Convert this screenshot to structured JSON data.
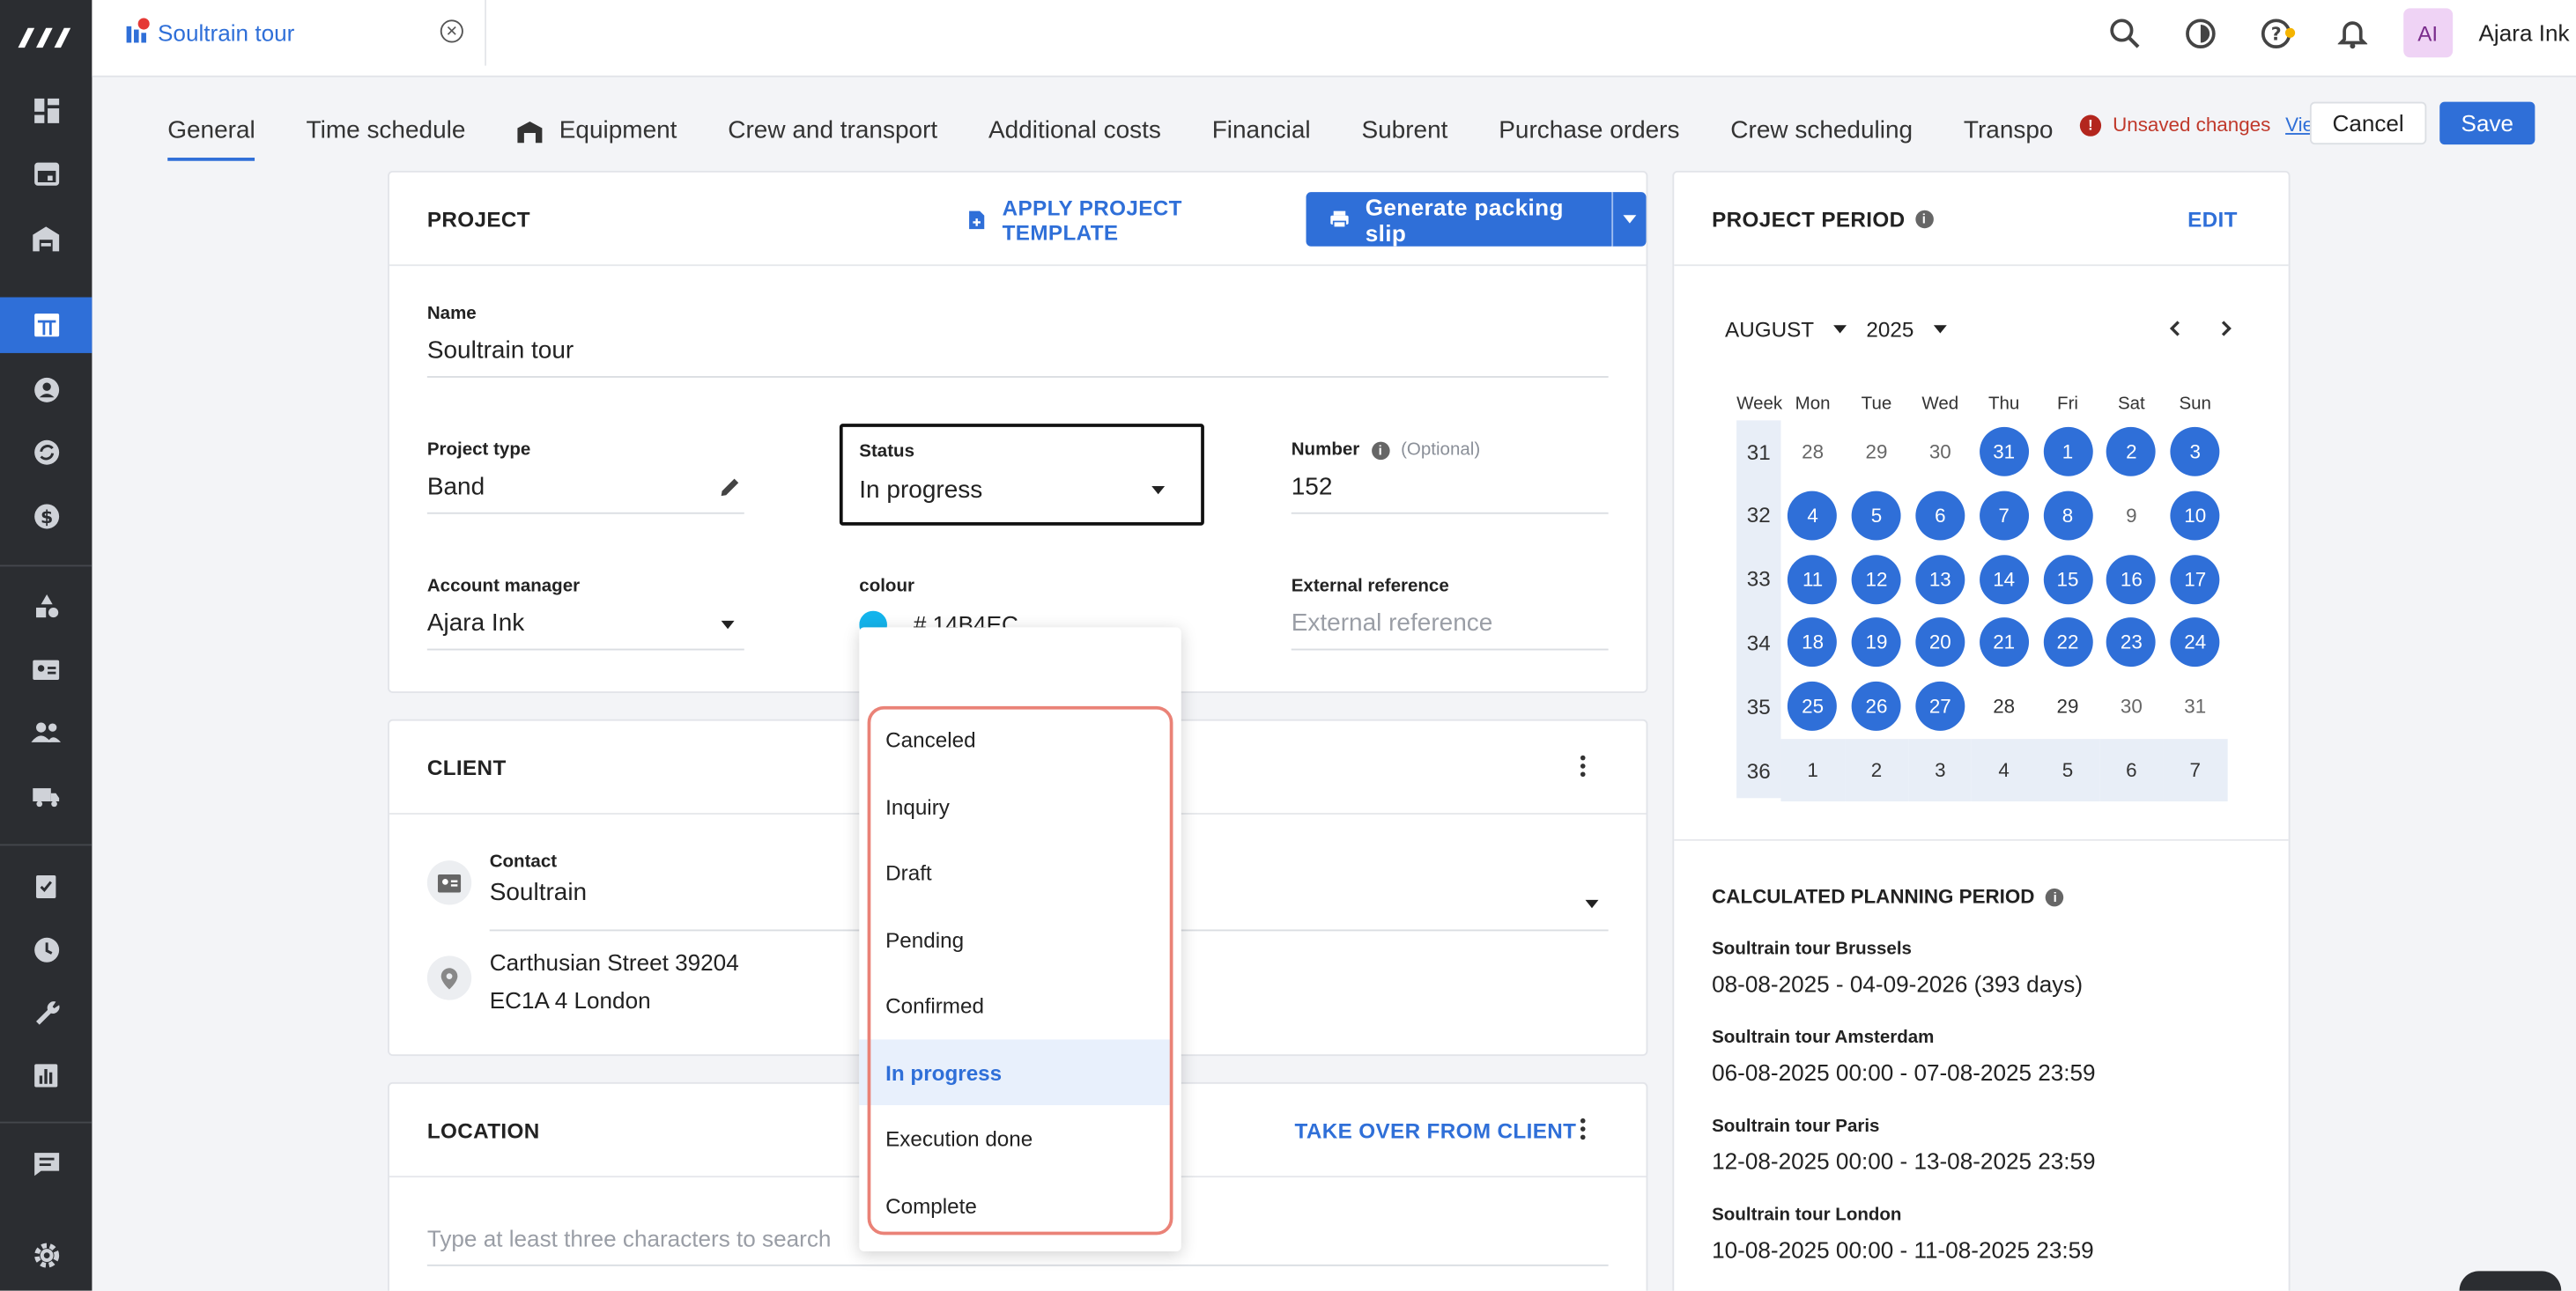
{
  "colors": {
    "accent": "#2f6fd8",
    "sidebar_bg": "#2b2d31",
    "highlight": "#ea8277",
    "swatch": "#14B4EC"
  },
  "window": {
    "tab_title": "Soultrain tour"
  },
  "user": {
    "initials": "AI",
    "name": "Ajara Ink"
  },
  "nav": {
    "tabs": [
      "General",
      "Time schedule",
      "Equipment",
      "Crew and transport",
      "Additional costs",
      "Financial",
      "Subrent",
      "Purchase orders",
      "Crew scheduling",
      "Transport pla"
    ],
    "active": "General"
  },
  "toolbar": {
    "unsaved": "Unsaved changes",
    "view": "View",
    "cancel": "Cancel",
    "save": "Save"
  },
  "project": {
    "heading": "PROJECT",
    "apply_template": "APPLY PROJECT TEMPLATE",
    "packing_slip": "Generate packing slip",
    "name_label": "Name",
    "name_value": "Soultrain tour",
    "type_label": "Project type",
    "type_value": "Band",
    "status_label": "Status",
    "status_value": "In progress",
    "number_label": "Number",
    "number_optional": "(Optional)",
    "number_value": "152",
    "manager_label": "Account manager",
    "manager_value": "Ajara Ink",
    "colour_label": "colour",
    "colour_value": "# 14B4EC",
    "extref_label": "External reference",
    "extref_placeholder": "External reference"
  },
  "client": {
    "heading": "CLIENT",
    "contact_label": "Contact",
    "contact_value": "Soultrain",
    "address_line1": "Carthusian Street 39204",
    "address_line2": "EC1A 4 London"
  },
  "location": {
    "heading": "LOCATION",
    "take_over": "TAKE OVER FROM CLIENT",
    "search_placeholder": "Type at least three characters to search"
  },
  "status_dropdown": {
    "options": [
      "Canceled",
      "Inquiry",
      "Draft",
      "Pending",
      "Confirmed",
      "In progress",
      "Execution done",
      "Complete"
    ],
    "selected": "In progress"
  },
  "period": {
    "heading": "PROJECT PERIOD",
    "edit": "EDIT",
    "month": "AUGUST",
    "year": "2025",
    "weekdays": [
      "Week",
      "Mon",
      "Tue",
      "Wed",
      "Thu",
      "Fri",
      "Sat",
      "Sun"
    ],
    "weeks": [
      {
        "week": "31",
        "days": [
          {
            "d": "28",
            "s": "out"
          },
          {
            "d": "29",
            "s": "out"
          },
          {
            "d": "30",
            "s": "out"
          },
          {
            "d": "31",
            "s": "sel"
          },
          {
            "d": "1",
            "s": "sel"
          },
          {
            "d": "2",
            "s": "sel"
          },
          {
            "d": "3",
            "s": "sel"
          }
        ]
      },
      {
        "week": "32",
        "days": [
          {
            "d": "4",
            "s": "sel"
          },
          {
            "d": "5",
            "s": "sel"
          },
          {
            "d": "6",
            "s": "sel"
          },
          {
            "d": "7",
            "s": "sel"
          },
          {
            "d": "8",
            "s": "sel"
          },
          {
            "d": "9",
            "s": "out"
          },
          {
            "d": "10",
            "s": "sel"
          }
        ]
      },
      {
        "week": "33",
        "days": [
          {
            "d": "11",
            "s": "sel"
          },
          {
            "d": "12",
            "s": "sel"
          },
          {
            "d": "13",
            "s": "sel"
          },
          {
            "d": "14",
            "s": "sel"
          },
          {
            "d": "15",
            "s": "sel"
          },
          {
            "d": "16",
            "s": "sel"
          },
          {
            "d": "17",
            "s": "sel"
          }
        ]
      },
      {
        "week": "34",
        "days": [
          {
            "d": "18",
            "s": "sel"
          },
          {
            "d": "19",
            "s": "sel"
          },
          {
            "d": "20",
            "s": "sel"
          },
          {
            "d": "21",
            "s": "sel"
          },
          {
            "d": "22",
            "s": "sel"
          },
          {
            "d": "23",
            "s": "sel"
          },
          {
            "d": "24",
            "s": "sel"
          }
        ]
      },
      {
        "week": "35",
        "days": [
          {
            "d": "25",
            "s": "sel"
          },
          {
            "d": "26",
            "s": "sel"
          },
          {
            "d": "27",
            "s": "sel"
          },
          {
            "d": "28",
            "s": ""
          },
          {
            "d": "29",
            "s": ""
          },
          {
            "d": "30",
            "s": "out"
          },
          {
            "d": "31",
            "s": "out"
          }
        ]
      },
      {
        "week": "36",
        "days": [
          {
            "d": "1",
            "s": "range"
          },
          {
            "d": "2",
            "s": "range"
          },
          {
            "d": "3",
            "s": "range"
          },
          {
            "d": "4",
            "s": "range"
          },
          {
            "d": "5",
            "s": "range"
          },
          {
            "d": "6",
            "s": "range"
          },
          {
            "d": "7",
            "s": "range"
          }
        ]
      }
    ]
  },
  "planning": {
    "heading": "CALCULATED PLANNING PERIOD",
    "items": [
      {
        "title": "Soultrain tour Brussels",
        "value": "08-08-2025 - 04-09-2026 (393 days)"
      },
      {
        "title": "Soultrain tour Amsterdam",
        "value": "06-08-2025 00:00 - 07-08-2025 23:59"
      },
      {
        "title": "Soultrain tour Paris",
        "value": "12-08-2025 00:00 - 13-08-2025 23:59"
      },
      {
        "title": "Soultrain tour London",
        "value": "10-08-2025 00:00 - 11-08-2025 23:59"
      }
    ]
  }
}
